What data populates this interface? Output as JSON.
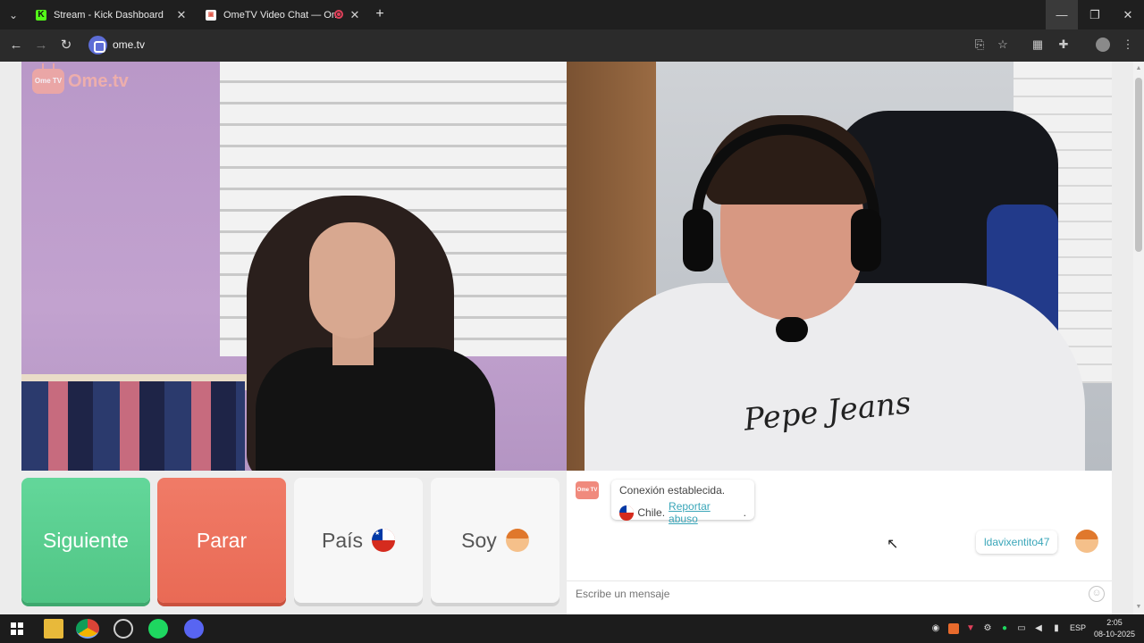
{
  "browser": {
    "tabs": [
      {
        "title": "Stream - Kick Dashboard",
        "favicon": "kick-icon",
        "color": "#53fc18"
      },
      {
        "title": "OmeTV Video Chat — Ome",
        "favicon": "ometv-icon",
        "color": "#f08a7d"
      }
    ],
    "url": "ome.tv"
  },
  "ometv": {
    "logo_badge": "Ome TV",
    "logo_text": "Ome.tv",
    "hoodie_text": "Pepe Jeans",
    "buttons": {
      "next": "Siguiente",
      "stop": "Parar",
      "country": "País",
      "soy": "Soy"
    },
    "colors": {
      "next": "#5bd08f",
      "stop": "#ec725e",
      "link": "#3aa6b9"
    },
    "chat": {
      "system_line1": "Conexión establecida.",
      "country_name": "Chile.",
      "report_link": "Reportar abuso",
      "report_suffix": ".",
      "username": "ldavixentito47",
      "input_placeholder": "Escribe un mensaje"
    }
  },
  "taskbar": {
    "language": "ESP",
    "time": "2:05",
    "date": "08-10-2025"
  }
}
